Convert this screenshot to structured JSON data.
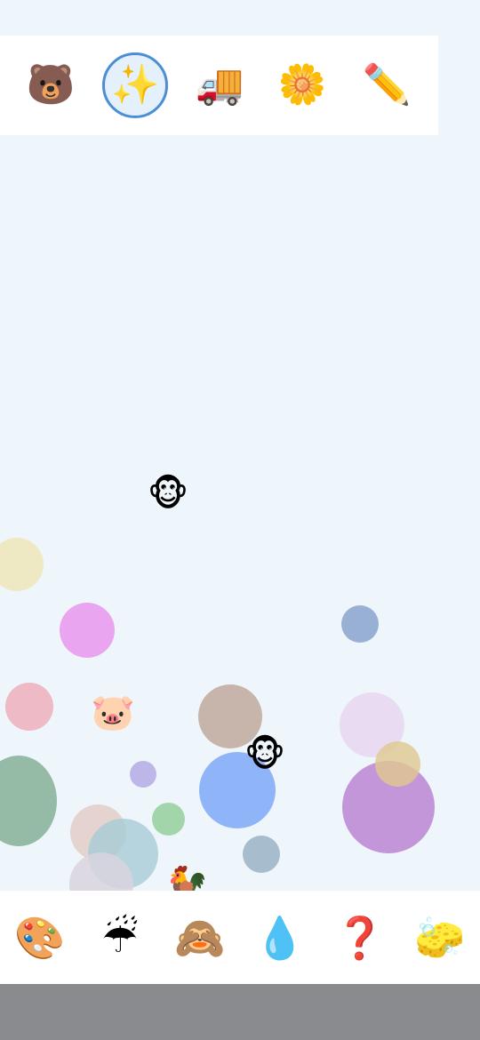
{
  "top_toolbar": {
    "tools": [
      {
        "name": "bear-icon",
        "glyph": "🐻",
        "selected": false
      },
      {
        "name": "sparkles-icon",
        "glyph": "✨",
        "selected": true
      },
      {
        "name": "truck-icon",
        "glyph": "🚚",
        "selected": false
      },
      {
        "name": "flower-icon",
        "glyph": "🌼",
        "selected": false
      },
      {
        "name": "pencil-icon",
        "glyph": "✏️",
        "selected": false
      }
    ],
    "selection_color": "#4a8fd6"
  },
  "canvas": {
    "stickers": [
      {
        "name": "monkey-sticker",
        "glyph": "🐵"
      },
      {
        "name": "pig-sticker",
        "glyph": "🐷"
      },
      {
        "name": "monkey-sticker",
        "glyph": "🐵"
      },
      {
        "name": "rooster-sticker",
        "glyph": "🐓"
      }
    ],
    "bubble_colors": [
      "#efe6b8",
      "#e99cee",
      "#8fa8d0",
      "#ecb4c0",
      "#c4b0a6",
      "#e8d8ef",
      "#b6b0e6",
      "#8ab0d8",
      "#e0c890",
      "#bf90d6",
      "#8fb6a0",
      "#9ad2a2",
      "#e2ccc6",
      "#a6ccd6",
      "#d8d4de",
      "#9fb6c8"
    ]
  },
  "bottom_toolbar": {
    "tools": [
      {
        "name": "palette-icon",
        "glyph": "🎨"
      },
      {
        "name": "umbrella-rain-icon",
        "glyph": "☔"
      },
      {
        "name": "see-no-evil-monkey-icon",
        "glyph": "🙈"
      },
      {
        "name": "droplet-icon",
        "glyph": "💧"
      },
      {
        "name": "question-mark-icon",
        "glyph": "❓"
      },
      {
        "name": "sponge-icon",
        "glyph": "🧽"
      }
    ]
  }
}
